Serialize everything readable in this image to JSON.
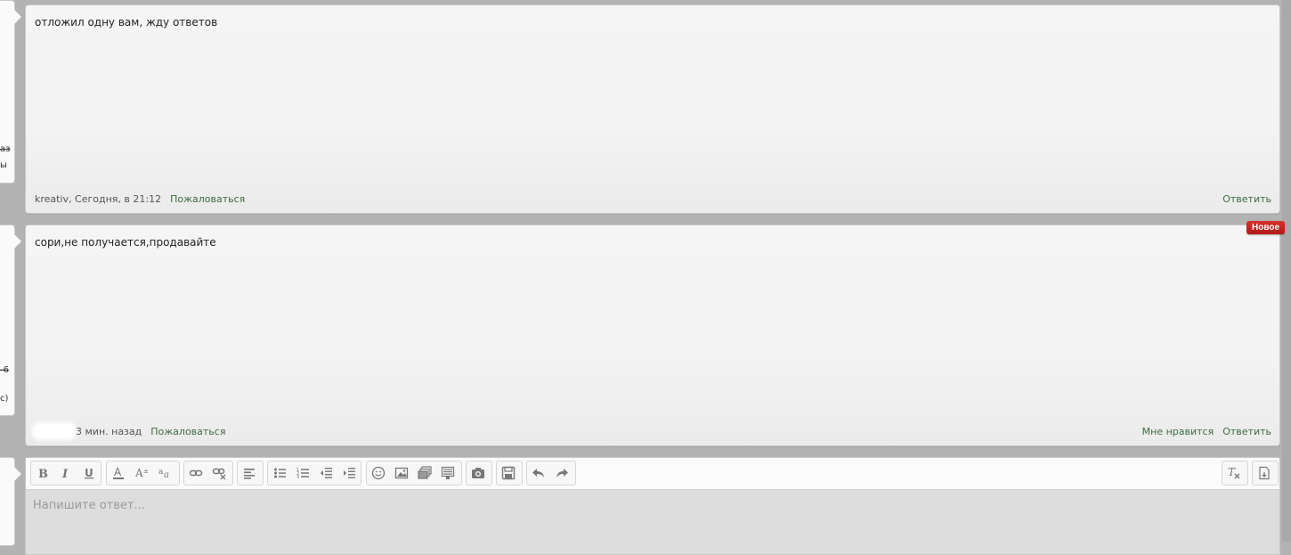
{
  "messages": [
    {
      "text": "отложил одну вам, жду ответов",
      "author": "kreativ",
      "time": ", Сегодня, в 21:12",
      "report": "Пожаловаться",
      "reply": "Ответить"
    },
    {
      "text": "сори,не получается,продавайте",
      "time": "3 мин. назад",
      "report": "Пожаловаться",
      "like": "Мне нравится",
      "reply": "Ответить",
      "badge": "Новое"
    }
  ],
  "left_fragments": {
    "panel1": [
      "аз",
      "ы"
    ],
    "panel2": [
      "-6",
      "с)"
    ]
  },
  "editor": {
    "placeholder": "Напишите ответ..."
  },
  "colors": {
    "link": "#3e6b3e",
    "badge": "#c8241f"
  }
}
